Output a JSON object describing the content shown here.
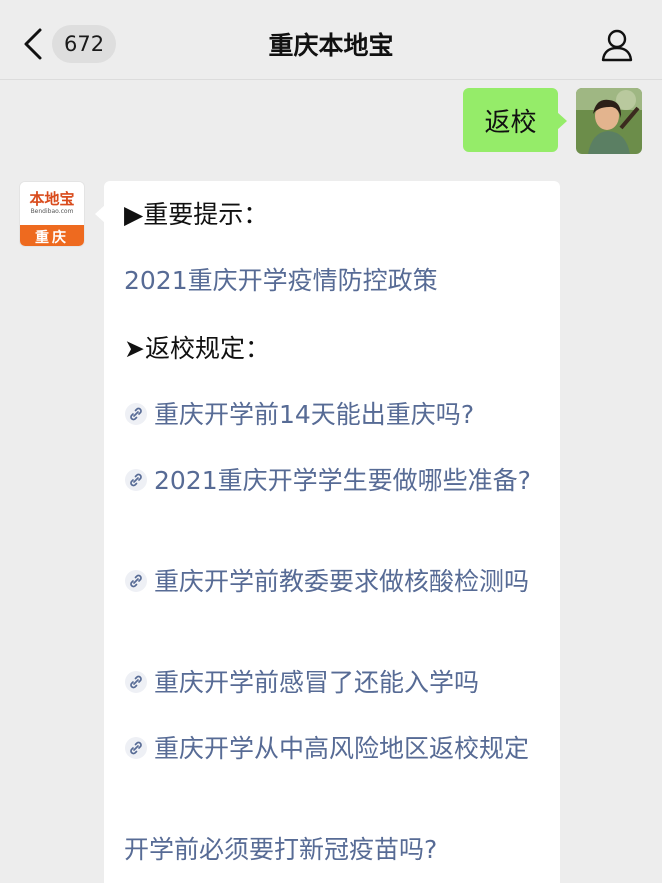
{
  "header": {
    "back_icon": "chevron-left-icon",
    "unread_count": "672",
    "title": "重庆本地宝",
    "profile_icon": "person-icon"
  },
  "chat": {
    "sent_message": {
      "text": "返校",
      "bubble_color": "#95ec69"
    },
    "brand_avatar": {
      "logo_text": "本地宝",
      "url_text": "Bendibao.com",
      "city": "重庆",
      "accent": "#ee6a1f"
    },
    "received_message": {
      "heading_important": "▶重要提示：",
      "policy_link": "2021重庆开学疫情防控政策",
      "heading_return": "➤返校规定：",
      "links": [
        "重庆开学前14天能出重庆吗?",
        "2021重庆开学学生要做哪些准备?",
        "重庆开学前教委要求做核酸检测吗",
        "重庆开学前感冒了还能入学吗",
        "重庆开学从中高风险地区返校规定"
      ],
      "vaccine_link": "开学前必须要打新冠疫苗吗?",
      "link_icon": "link-icon",
      "link_color": "#576b95"
    }
  }
}
